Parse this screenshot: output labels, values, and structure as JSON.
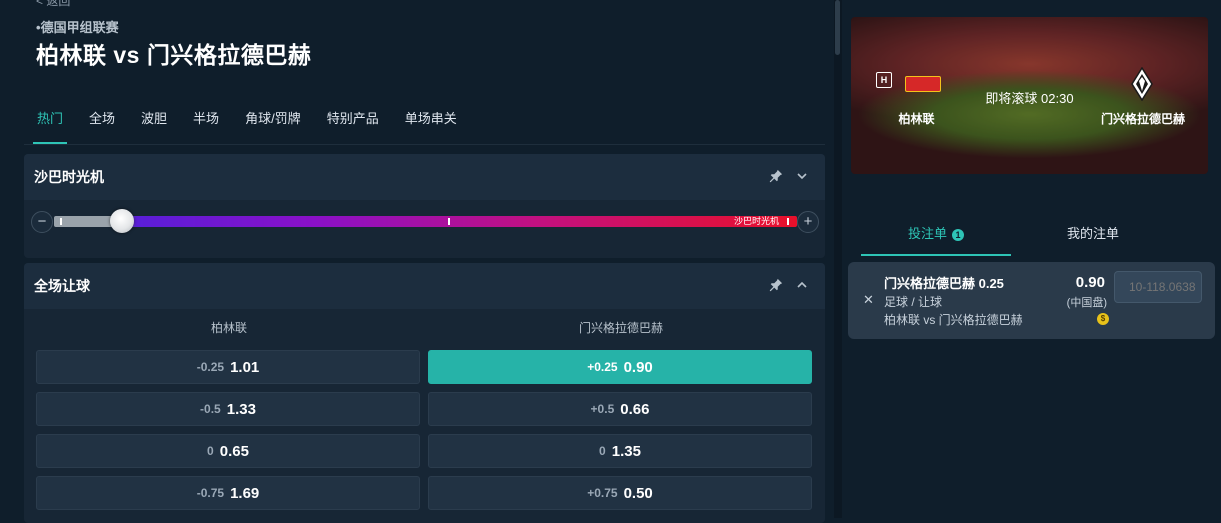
{
  "header": {
    "back_label": "< 返回",
    "league": "德国甲组联赛",
    "match_title": "柏林联 vs 门兴格拉德巴赫"
  },
  "tabs": [
    {
      "label": "热门"
    },
    {
      "label": "全场"
    },
    {
      "label": "波胆"
    },
    {
      "label": "半场"
    },
    {
      "label": "角球/罚牌"
    },
    {
      "label": "特别产品"
    },
    {
      "label": "单场串关"
    }
  ],
  "time_machine": {
    "title": "沙巴时光机",
    "track_label": "沙巴时光机",
    "minus": "−",
    "plus": "+"
  },
  "handicap": {
    "title": "全场让球",
    "home_team": "柏林联",
    "away_team": "门兴格拉德巴赫",
    "rows": [
      {
        "home_line": "-0.25",
        "home_odd": "1.01",
        "away_line": "+0.25",
        "away_odd": "0.90"
      },
      {
        "home_line": "-0.5",
        "home_odd": "1.33",
        "away_line": "+0.5",
        "away_odd": "0.66"
      },
      {
        "home_line": "0",
        "home_odd": "0.65",
        "away_line": "0",
        "away_odd": "1.35"
      },
      {
        "home_line": "-0.75",
        "home_odd": "1.69",
        "away_line": "+0.75",
        "away_odd": "0.50"
      }
    ]
  },
  "scoreboard": {
    "home_badge": "H",
    "status": "即将滚球 02:30",
    "home_team": "柏林联",
    "away_team": "门兴格拉德巴赫"
  },
  "bet_slip": {
    "tab_slip": "投注单",
    "tab_count": "1",
    "tab_my_bets": "我的注单",
    "selection": "门兴格拉德巴赫 0.25",
    "market": "足球 / 让球",
    "event": "柏林联 vs 门兴格拉德巴赫",
    "odd": "0.90",
    "odds_type": "(中国盘)",
    "coin": "$",
    "stake_placeholder": "10-118.0638"
  },
  "colors": {
    "accent": "#2ec4b6",
    "selected_odds": "#26b3a8",
    "background": "#0f1e2b"
  },
  "icons": [
    "pin-icon",
    "chevron-down-icon",
    "chevron-up-icon",
    "close-icon",
    "coin-icon"
  ]
}
